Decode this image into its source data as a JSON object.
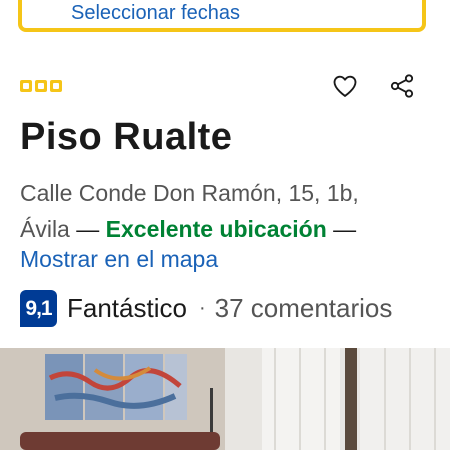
{
  "date_selector": {
    "label": "Seleccionar fechas"
  },
  "property": {
    "star_rating": 3,
    "name": "Piso Rualte",
    "address_line1": "Calle Conde Don Ramón, 15, 1b,",
    "city": "Ávila",
    "dash": "—",
    "location_badge": "Excelente ubicación",
    "map_link": "Mostrar en el mapa"
  },
  "rating": {
    "score": "9,1",
    "label": "Fantástico",
    "separator": "·",
    "reviews": "37 comentarios"
  },
  "colors": {
    "accent_yellow": "#f5c518",
    "link_blue": "#1a62b7",
    "score_blue": "#003b95",
    "location_green": "#008234"
  },
  "icons": {
    "favorite": "heart-icon",
    "share": "share-icon",
    "stars": "star-rating-icon"
  }
}
